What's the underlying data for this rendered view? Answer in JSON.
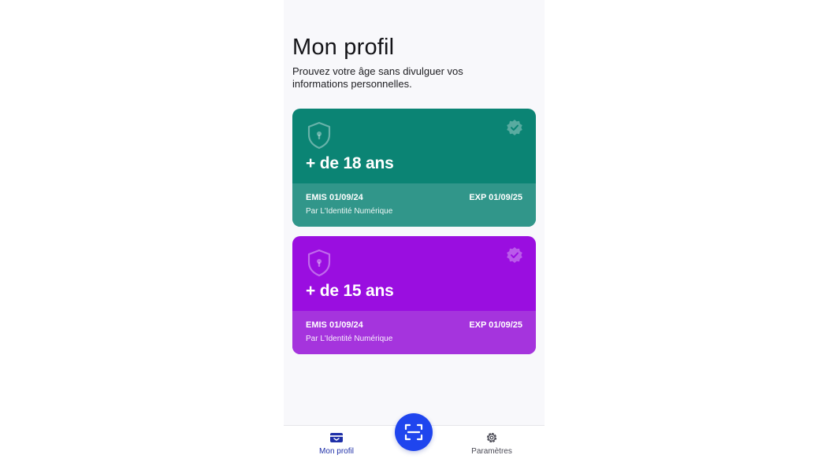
{
  "header": {
    "title": "Mon profil",
    "subtitle": "Prouvez votre âge sans divulguer vos informations personnelles."
  },
  "cards": [
    {
      "label": "+ de 18 ans",
      "issued": "EMIS 01/09/24",
      "expires": "EXP 01/09/25",
      "issuer": "Par L'Identité Numérique",
      "color": "#0b8474"
    },
    {
      "label": "+ de 15 ans",
      "issued": "EMIS 01/09/24",
      "expires": "EXP 01/09/25",
      "issuer": "Par L'Identité Numérique",
      "color": "#9a0ee0"
    }
  ],
  "nav": {
    "profile_label": "Mon profil",
    "settings_label": "Paramètres",
    "active": "profile",
    "active_color": "#1e2fa8",
    "scan_color": "#1f45ee"
  },
  "icons": {
    "card_main": "shield-lock-icon",
    "card_badge": "verified-badge-icon",
    "nav_profile": "wallet-icon",
    "nav_scan": "qr-scan-icon",
    "nav_settings": "gear-icon"
  }
}
